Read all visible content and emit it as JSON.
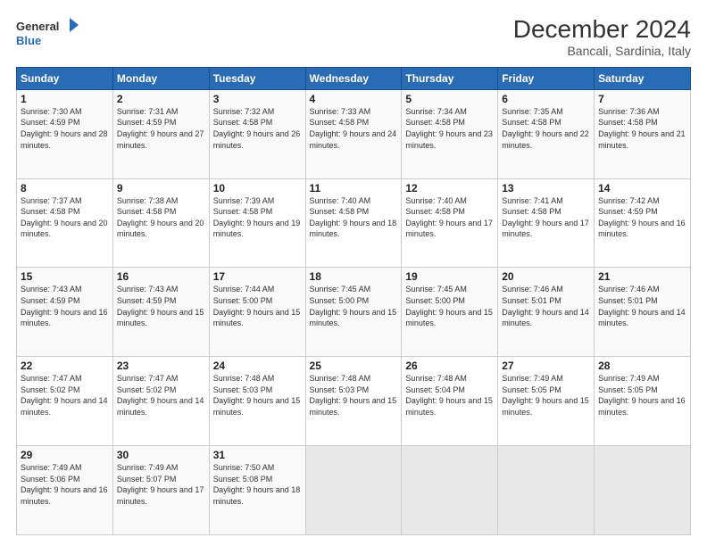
{
  "logo": {
    "line1": "General",
    "line2": "Blue"
  },
  "title": "December 2024",
  "subtitle": "Bancali, Sardinia, Italy",
  "days_header": [
    "Sunday",
    "Monday",
    "Tuesday",
    "Wednesday",
    "Thursday",
    "Friday",
    "Saturday"
  ],
  "weeks": [
    [
      {
        "day": 1,
        "sunrise": "7:30 AM",
        "sunset": "4:59 PM",
        "daylight": "9 hours and 28 minutes."
      },
      {
        "day": 2,
        "sunrise": "7:31 AM",
        "sunset": "4:59 PM",
        "daylight": "9 hours and 27 minutes."
      },
      {
        "day": 3,
        "sunrise": "7:32 AM",
        "sunset": "4:58 PM",
        "daylight": "9 hours and 26 minutes."
      },
      {
        "day": 4,
        "sunrise": "7:33 AM",
        "sunset": "4:58 PM",
        "daylight": "9 hours and 24 minutes."
      },
      {
        "day": 5,
        "sunrise": "7:34 AM",
        "sunset": "4:58 PM",
        "daylight": "9 hours and 23 minutes."
      },
      {
        "day": 6,
        "sunrise": "7:35 AM",
        "sunset": "4:58 PM",
        "daylight": "9 hours and 22 minutes."
      },
      {
        "day": 7,
        "sunrise": "7:36 AM",
        "sunset": "4:58 PM",
        "daylight": "9 hours and 21 minutes."
      }
    ],
    [
      {
        "day": 8,
        "sunrise": "7:37 AM",
        "sunset": "4:58 PM",
        "daylight": "9 hours and 20 minutes."
      },
      {
        "day": 9,
        "sunrise": "7:38 AM",
        "sunset": "4:58 PM",
        "daylight": "9 hours and 20 minutes."
      },
      {
        "day": 10,
        "sunrise": "7:39 AM",
        "sunset": "4:58 PM",
        "daylight": "9 hours and 19 minutes."
      },
      {
        "day": 11,
        "sunrise": "7:40 AM",
        "sunset": "4:58 PM",
        "daylight": "9 hours and 18 minutes."
      },
      {
        "day": 12,
        "sunrise": "7:40 AM",
        "sunset": "4:58 PM",
        "daylight": "9 hours and 17 minutes."
      },
      {
        "day": 13,
        "sunrise": "7:41 AM",
        "sunset": "4:58 PM",
        "daylight": "9 hours and 17 minutes."
      },
      {
        "day": 14,
        "sunrise": "7:42 AM",
        "sunset": "4:59 PM",
        "daylight": "9 hours and 16 minutes."
      }
    ],
    [
      {
        "day": 15,
        "sunrise": "7:43 AM",
        "sunset": "4:59 PM",
        "daylight": "9 hours and 16 minutes."
      },
      {
        "day": 16,
        "sunrise": "7:43 AM",
        "sunset": "4:59 PM",
        "daylight": "9 hours and 15 minutes."
      },
      {
        "day": 17,
        "sunrise": "7:44 AM",
        "sunset": "5:00 PM",
        "daylight": "9 hours and 15 minutes."
      },
      {
        "day": 18,
        "sunrise": "7:45 AM",
        "sunset": "5:00 PM",
        "daylight": "9 hours and 15 minutes."
      },
      {
        "day": 19,
        "sunrise": "7:45 AM",
        "sunset": "5:00 PM",
        "daylight": "9 hours and 15 minutes."
      },
      {
        "day": 20,
        "sunrise": "7:46 AM",
        "sunset": "5:01 PM",
        "daylight": "9 hours and 14 minutes."
      },
      {
        "day": 21,
        "sunrise": "7:46 AM",
        "sunset": "5:01 PM",
        "daylight": "9 hours and 14 minutes."
      }
    ],
    [
      {
        "day": 22,
        "sunrise": "7:47 AM",
        "sunset": "5:02 PM",
        "daylight": "9 hours and 14 minutes."
      },
      {
        "day": 23,
        "sunrise": "7:47 AM",
        "sunset": "5:02 PM",
        "daylight": "9 hours and 14 minutes."
      },
      {
        "day": 24,
        "sunrise": "7:48 AM",
        "sunset": "5:03 PM",
        "daylight": "9 hours and 15 minutes."
      },
      {
        "day": 25,
        "sunrise": "7:48 AM",
        "sunset": "5:03 PM",
        "daylight": "9 hours and 15 minutes."
      },
      {
        "day": 26,
        "sunrise": "7:48 AM",
        "sunset": "5:04 PM",
        "daylight": "9 hours and 15 minutes."
      },
      {
        "day": 27,
        "sunrise": "7:49 AM",
        "sunset": "5:05 PM",
        "daylight": "9 hours and 15 minutes."
      },
      {
        "day": 28,
        "sunrise": "7:49 AM",
        "sunset": "5:05 PM",
        "daylight": "9 hours and 16 minutes."
      }
    ],
    [
      {
        "day": 29,
        "sunrise": "7:49 AM",
        "sunset": "5:06 PM",
        "daylight": "9 hours and 16 minutes."
      },
      {
        "day": 30,
        "sunrise": "7:49 AM",
        "sunset": "5:07 PM",
        "daylight": "9 hours and 17 minutes."
      },
      {
        "day": 31,
        "sunrise": "7:50 AM",
        "sunset": "5:08 PM",
        "daylight": "9 hours and 18 minutes."
      },
      null,
      null,
      null,
      null
    ]
  ],
  "labels": {
    "sunrise": "Sunrise:",
    "sunset": "Sunset:",
    "daylight": "Daylight:"
  }
}
